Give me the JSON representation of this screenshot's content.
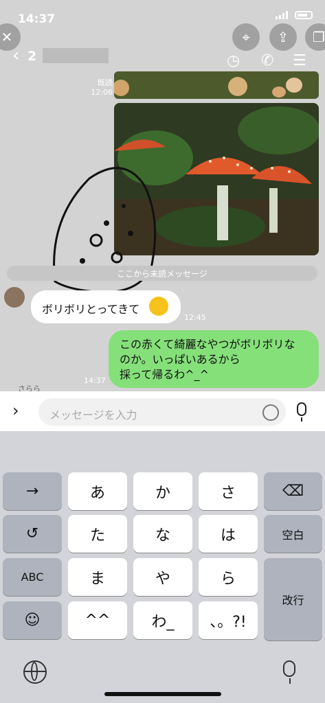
{
  "status": {
    "time": "14:37"
  },
  "header": {
    "back_glyph": "‹",
    "unread_count": "2"
  },
  "messages": {
    "read_label": "既読",
    "read_time": "12:06",
    "unread_divider": "ここから未読メッセージ",
    "incoming_text": "ボリボリとってきて",
    "incoming_time": "12:45",
    "outgoing_lines": [
      "この赤くて綺麗なやつがボリボリな",
      "のか。いっぱいあるから",
      "採って帰るわ^_^"
    ],
    "bottom_time": "14:37",
    "bottom_name": "さらら"
  },
  "input": {
    "placeholder": "メッセージを入力"
  },
  "keyboard": {
    "rows": [
      [
        "→",
        "あ",
        "か",
        "さ",
        "⌫"
      ],
      [
        "↺",
        "た",
        "な",
        "は",
        "空白"
      ],
      [
        "ABC",
        "ま",
        "や",
        "ら",
        "改行"
      ],
      [
        "☺",
        "^^",
        "わ_",
        "、。?!"
      ]
    ]
  }
}
